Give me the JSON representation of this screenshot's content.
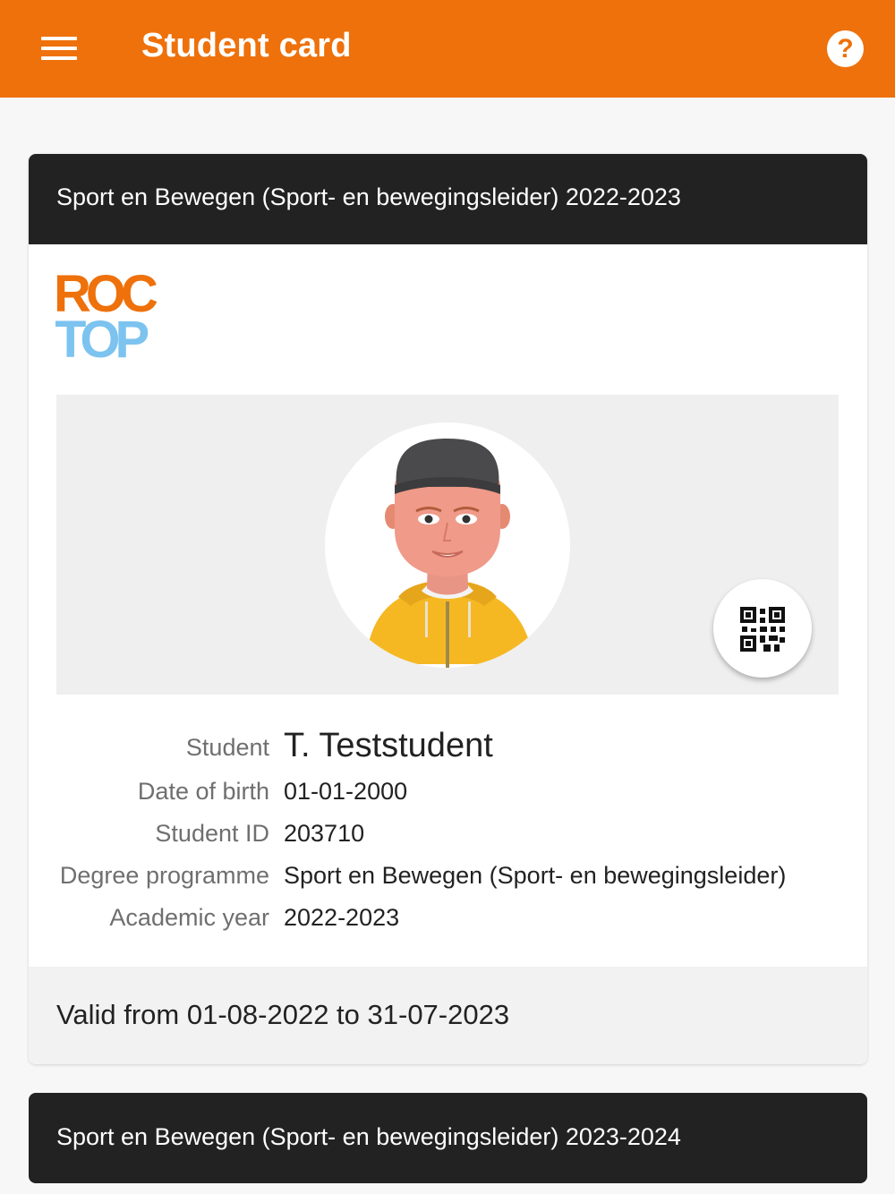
{
  "app_bar": {
    "title": "Student card",
    "menu_icon": "hamburger-menu-icon",
    "help_icon": "help-icon",
    "help_glyph": "?",
    "color": "#ee710b"
  },
  "card": {
    "header_title": "Sport en Bewegen (Sport- en bewegingsleider) 2022-2023",
    "logo": {
      "line1": "ROC",
      "line2": "TOP",
      "line1_color": "#ee710b",
      "line2_color": "#7cc3ef"
    },
    "qr_icon": "qr-code-icon",
    "fields": {
      "student": {
        "label": "Student",
        "value": "T. Teststudent"
      },
      "dob": {
        "label": "Date of birth",
        "value": "01-01-2000"
      },
      "student_id": {
        "label": "Student ID",
        "value": "203710"
      },
      "programme": {
        "label": "Degree programme",
        "value": "Sport en Bewegen (Sport- en bewegingsleider)"
      },
      "academic_year": {
        "label": "Academic year",
        "value": "2022-2023"
      }
    },
    "validity": "Valid from 01-08-2022 to 31-07-2023"
  },
  "card2": {
    "header_title": "Sport en Bewegen (Sport- en bewegingsleider) 2023-2024"
  }
}
